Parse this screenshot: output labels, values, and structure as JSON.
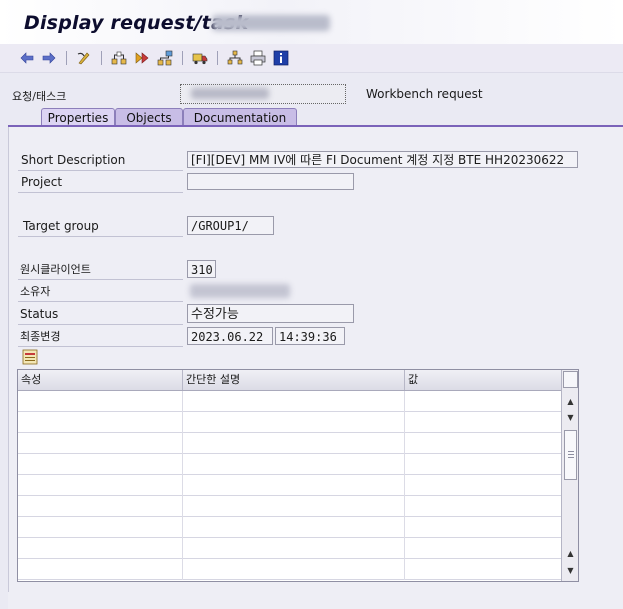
{
  "window": {
    "title": "Display request/task"
  },
  "toolbar": {
    "buttons": [
      {
        "icon": "back-arrow-icon"
      },
      {
        "icon": "forward-arrow-icon"
      },
      {
        "icon": "display-change-icon"
      },
      {
        "icon": "hierarchy-icon"
      },
      {
        "icon": "next-level-icon"
      },
      {
        "icon": "structure-icon"
      },
      {
        "icon": "transport-truck-icon"
      },
      {
        "icon": "tree-icon"
      },
      {
        "icon": "print-icon"
      },
      {
        "icon": "info-icon"
      }
    ]
  },
  "header": {
    "request_label": "요청/태스크",
    "request_type": "Workbench request"
  },
  "tabs": [
    {
      "label": "Properties",
      "active": true
    },
    {
      "label": "Objects",
      "active": false
    },
    {
      "label": "Documentation",
      "active": false
    }
  ],
  "properties": {
    "short_description_label": "Short Description",
    "short_description_value": "[FI][DEV] MM IV에 따른 FI Document 계정 지정 BTE HH20230622",
    "project_label": "Project",
    "project_value": "",
    "target_group_label": "Target group",
    "target_group_value": "/GROUP1/",
    "source_client_label": "원시클라이언트",
    "source_client_value": "310",
    "owner_label": "소유자",
    "status_label": "Status",
    "status_value": "수정가능",
    "last_changed_label": "최종변경",
    "last_changed_date": "2023.06.22",
    "last_changed_time": "14:39:36"
  },
  "attributes_table": {
    "columns": [
      "속성",
      "간단한 설명",
      "값"
    ],
    "rows": 9
  },
  "colors": {
    "tab_active": "#dcd4f3",
    "tab_inactive": "#c8bde6",
    "tab_line": "#7b63b9",
    "background": "#eaeaf3"
  }
}
